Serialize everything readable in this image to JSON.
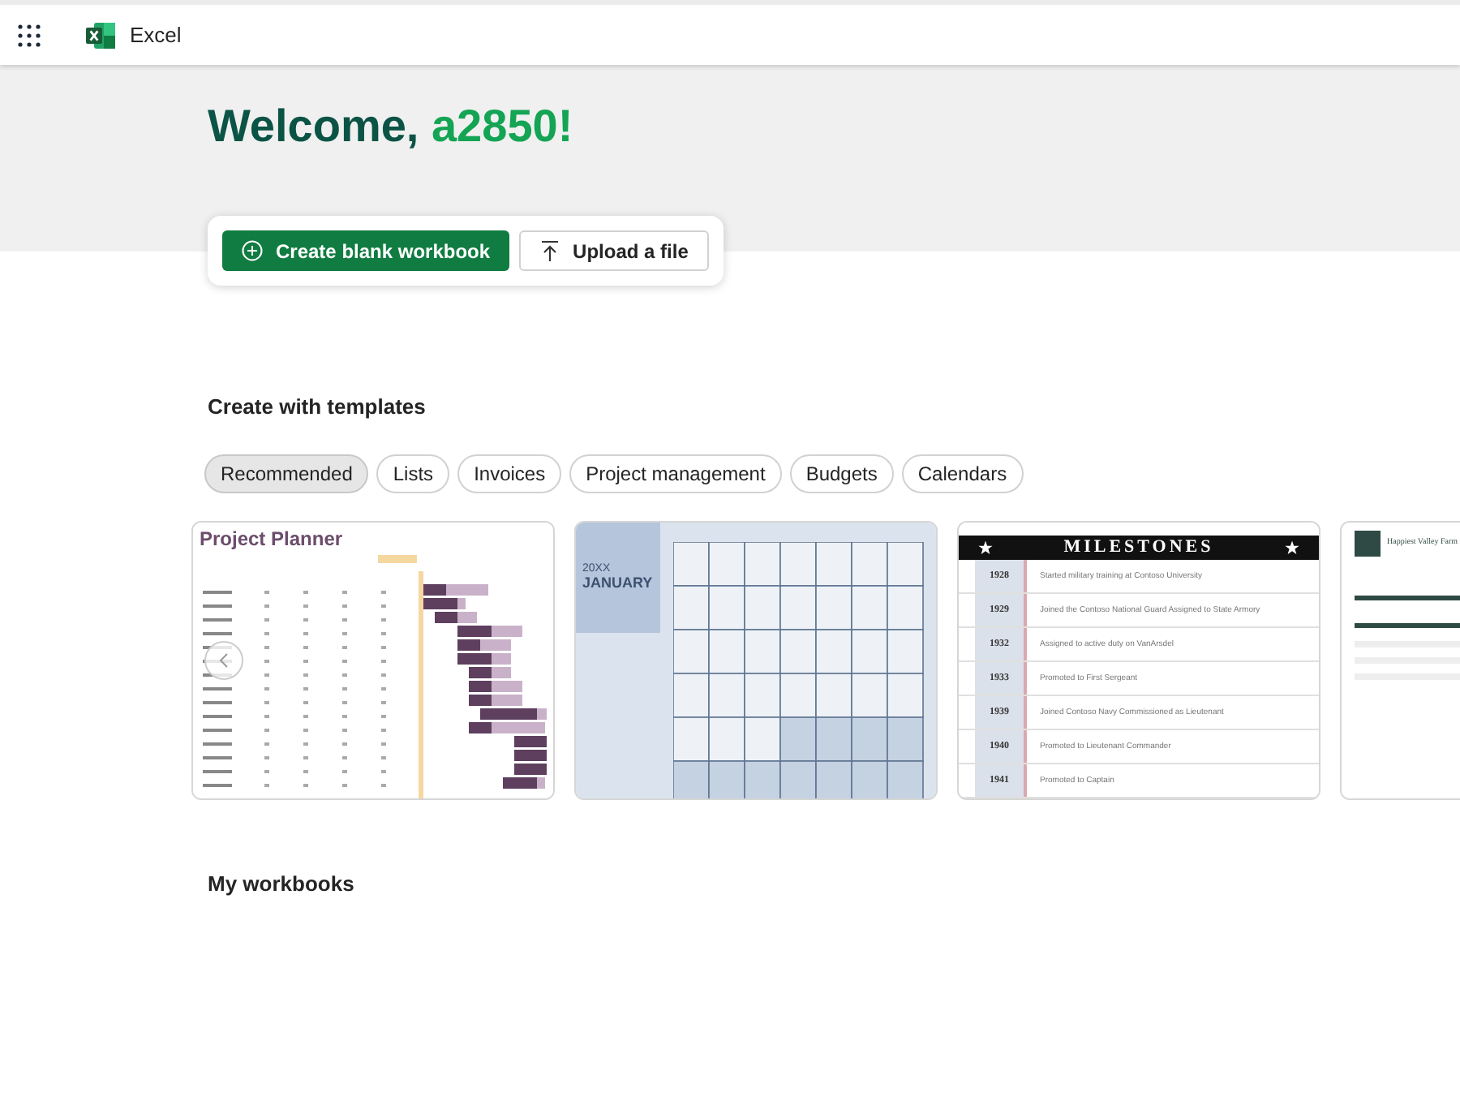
{
  "app": {
    "name": "Excel"
  },
  "welcome": {
    "greeting": "Welcome,",
    "user": "a2850!"
  },
  "actions": [
    {
      "kind": "create",
      "label": "Create blank workbook"
    },
    {
      "kind": "upload",
      "label": "Upload a file"
    }
  ],
  "templates": {
    "heading": "Create with templates",
    "filters": [
      {
        "label": "Recommended",
        "selected": true
      },
      {
        "label": "Lists",
        "selected": false
      },
      {
        "label": "Invoices",
        "selected": false
      },
      {
        "label": "Project management",
        "selected": false
      },
      {
        "label": "Budgets",
        "selected": false
      },
      {
        "label": "Calendars",
        "selected": false
      }
    ],
    "cards": [
      {
        "kind": "planner",
        "title": "Project Planner"
      },
      {
        "kind": "calendar",
        "year": "20XX",
        "title": "JANUARY"
      },
      {
        "kind": "milestones",
        "title": "MILESTONES",
        "entries": [
          {
            "year": "1928",
            "text": "Started military training at Contoso University"
          },
          {
            "year": "1929",
            "text": "Joined the Contoso National Guard Assigned to State Armory"
          },
          {
            "year": "1932",
            "text": "Assigned to active duty on VanArsdel"
          },
          {
            "year": "1933",
            "text": "Promoted to First Sergeant"
          },
          {
            "year": "1939",
            "text": "Joined Contoso Navy Commissioned as Lieutenant"
          },
          {
            "year": "1940",
            "text": "Promoted to Lieutenant Commander"
          },
          {
            "year": "1941",
            "text": "Promoted to Captain"
          }
        ]
      },
      {
        "kind": "invoice",
        "title": "Happiest Valley Farm"
      }
    ]
  },
  "my_workbooks": {
    "heading": "My workbooks"
  }
}
